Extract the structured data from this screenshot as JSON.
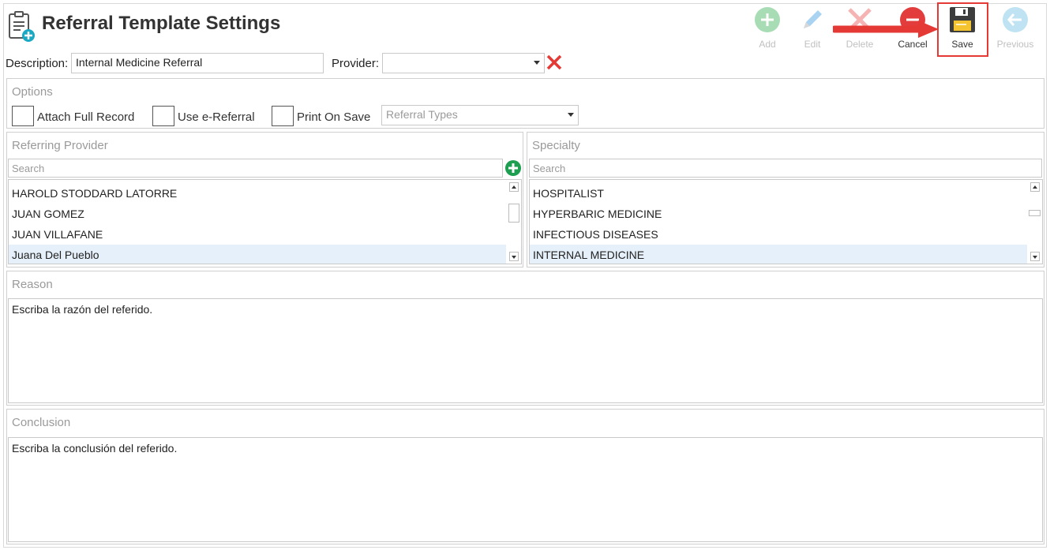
{
  "window": {
    "title": "Referral Template Settings"
  },
  "toolbar": {
    "add_label": "Add",
    "edit_label": "Edit",
    "delete_label": "Delete",
    "cancel_label": "Cancel",
    "save_label": "Save",
    "previous_label": "Previous"
  },
  "form": {
    "description_label": "Description:",
    "description_value": "Internal Medicine Referral",
    "provider_label": "Provider:",
    "provider_value": ""
  },
  "options": {
    "title": "Options",
    "attach_full_record_label": "Attach Full Record",
    "attach_full_record_checked": false,
    "use_ereferral_label": "Use e-Referral",
    "use_ereferral_checked": false,
    "print_on_save_label": "Print On Save",
    "print_on_save_checked": false,
    "referral_types_placeholder": "Referral Types"
  },
  "referring_provider": {
    "title": "Referring Provider",
    "search_placeholder": "Search",
    "items": [
      "HAROLD STODDARD LATORRE",
      "JUAN GOMEZ",
      "JUAN VILLAFANE",
      "Juana  Del Pueblo"
    ],
    "selected_index": 3
  },
  "specialty": {
    "title": "Specialty",
    "search_placeholder": "Search",
    "items": [
      "HOSPITALIST",
      "HYPERBARIC MEDICINE",
      "INFECTIOUS DISEASES",
      "INTERNAL MEDICINE"
    ],
    "selected_index": 3
  },
  "reason": {
    "title": "Reason",
    "text": "Escriba la razón del referido."
  },
  "conclusion": {
    "title": "Conclusion",
    "text": "Escriba la conclusión del referido."
  },
  "colors": {
    "add_green": "#a8dcb4",
    "edit_blue": "#a9d3f0",
    "delete_red": "#f6b3b3",
    "cancel_red": "#e23c3c",
    "previous_blue": "#bfe3f3",
    "highlight_red": "#e53935",
    "selection_bg": "#e6f0fa"
  }
}
